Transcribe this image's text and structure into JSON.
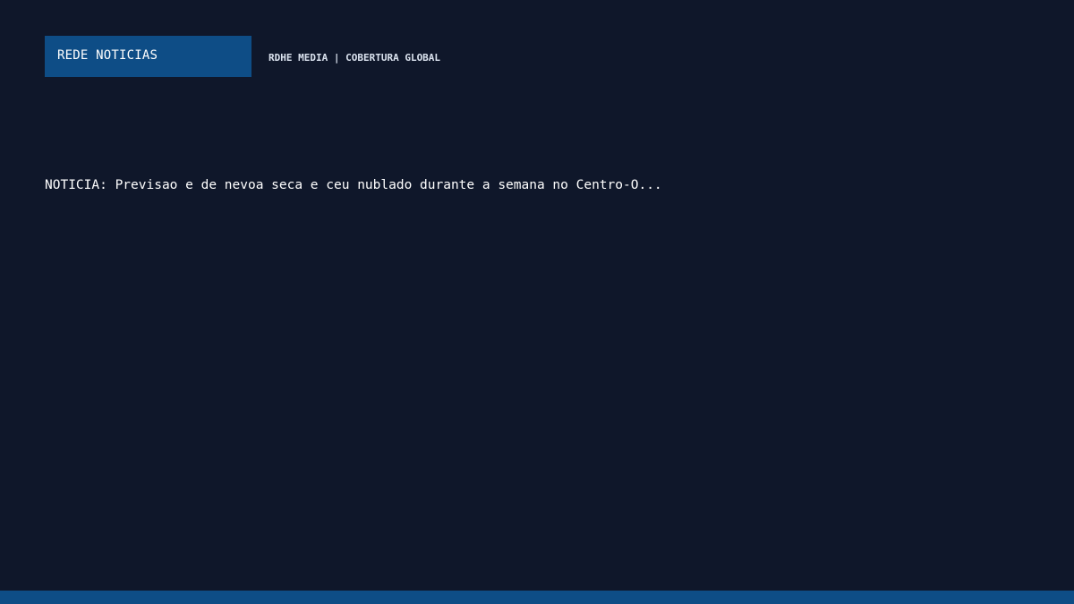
{
  "header": {
    "brand": "REDE NOTICIAS",
    "subtitle": "RDHE MEDIA | COBERTURA GLOBAL"
  },
  "main": {
    "headline": "NOTICIA: Previsao e de nevoa seca e ceu nublado durante a semana no Centro-O..."
  },
  "colors": {
    "background": "#0f172a",
    "accent": "#0e4d86",
    "text": "#ffffff"
  }
}
